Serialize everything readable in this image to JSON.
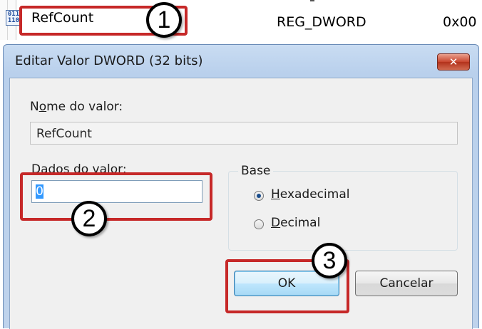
{
  "registry_row": {
    "value_name": "RefCount",
    "value_type": "REG_DWORD",
    "value_data": "0x00",
    "icon": "reg-dword-icon"
  },
  "callouts": [
    "1",
    "2",
    "3"
  ],
  "dialog": {
    "title": "Editar Valor DWORD (32 bits)",
    "close_symbol": "✕",
    "value_name_label_pre": "N",
    "value_name_label_ul": "o",
    "value_name_label_post": "me do valor:",
    "value_name": "RefCount",
    "value_data_label_pre": "",
    "value_data_label_ul": "D",
    "value_data_label_post": "ados do valor:",
    "value_data": "0",
    "base_group_label": "Base",
    "base_options": [
      {
        "ul": "H",
        "rest": "exadecimal",
        "checked": true
      },
      {
        "ul": "D",
        "rest": "ecimal",
        "checked": false
      }
    ],
    "ok_label": "OK",
    "cancel_label": "Cancelar"
  },
  "colors": {
    "highlight": "#c62828",
    "title_bar": "#c9dcf2",
    "selection": "#3399ff"
  }
}
